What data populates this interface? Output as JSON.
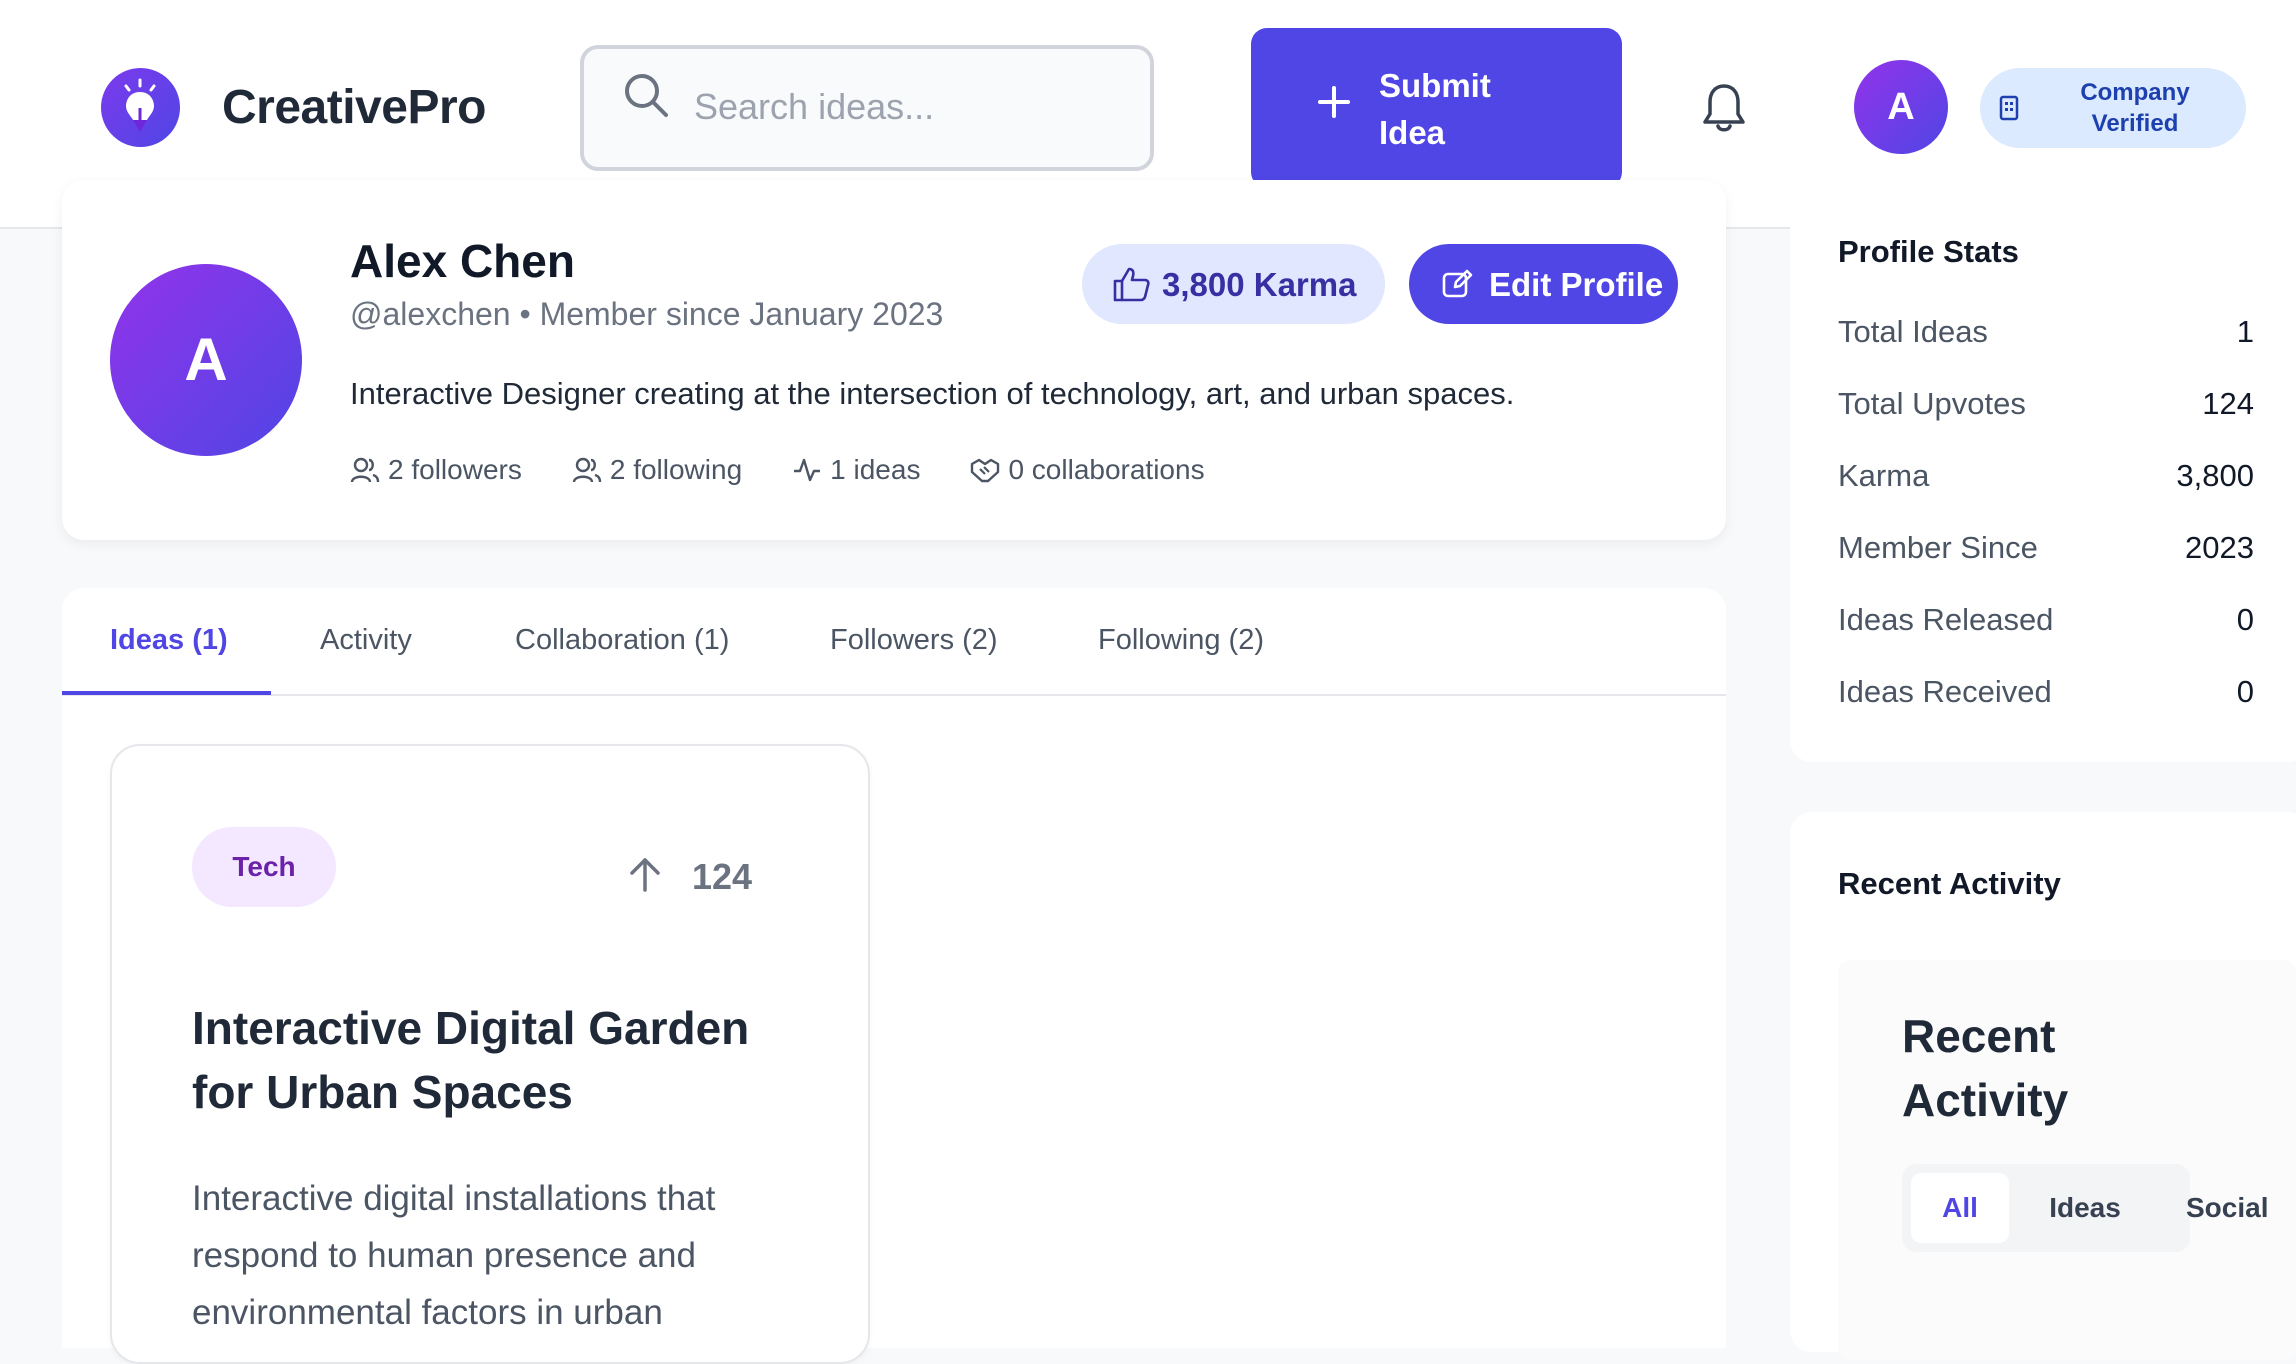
{
  "header": {
    "brand": "CreativePro",
    "search_placeholder": "Search ideas...",
    "submit_label": "Submit Idea",
    "avatar_initial": "A",
    "verified_label": "Company Verified"
  },
  "profile": {
    "avatar_initial": "A",
    "name": "Alex Chen",
    "subline": "@alexchen • Member since January 2023",
    "bio": "Interactive Designer creating at the intersection of technology, art, and urban spaces.",
    "followers": "2 followers",
    "following": "2 following",
    "ideas": "1 ideas",
    "collaborations": "0 collaborations",
    "karma_label": "3,800 Karma",
    "edit_label": "Edit Profile"
  },
  "tabs": [
    {
      "label": "Ideas (1)"
    },
    {
      "label": "Activity"
    },
    {
      "label": "Collaboration (1)"
    },
    {
      "label": "Followers (2)"
    },
    {
      "label": "Following (2)"
    }
  ],
  "idea_card": {
    "tag": "Tech",
    "upvotes": "124",
    "title": "Interactive Digital Garden for Urban Spaces",
    "description": "Interactive digital installations that respond to human presence and environmental factors in urban"
  },
  "profile_stats": {
    "title": "Profile Stats",
    "rows": [
      {
        "label": "Total Ideas",
        "value": "1"
      },
      {
        "label": "Total Upvotes",
        "value": "124"
      },
      {
        "label": "Karma",
        "value": "3,800"
      },
      {
        "label": "Member Since",
        "value": "2023"
      },
      {
        "label": "Ideas Released",
        "value": "0"
      },
      {
        "label": "Ideas Received",
        "value": "0"
      }
    ]
  },
  "recent_activity": {
    "title": "Recent Activity",
    "heading": "Recent Activity",
    "filters": [
      "All",
      "Ideas",
      "Social"
    ]
  },
  "colors": {
    "accent": "#4f46e5",
    "karma_bg": "#e0e7ff",
    "tag_bg": "#f3e8ff",
    "verified_bg": "#dbeafe"
  }
}
